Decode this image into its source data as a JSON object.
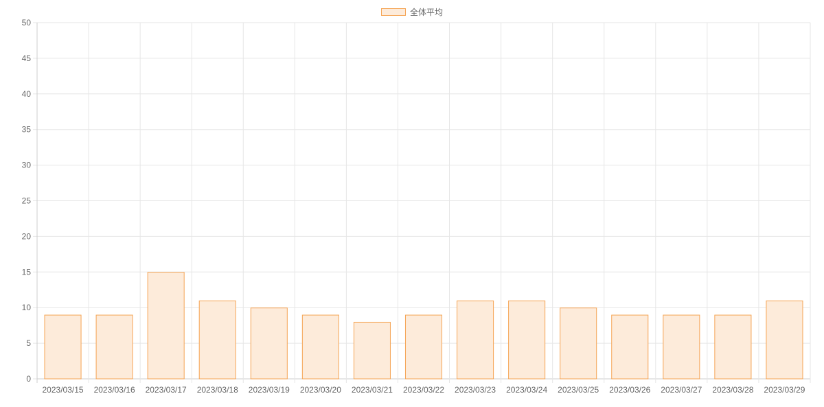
{
  "chart_data": {
    "type": "bar",
    "categories": [
      "2023/03/15",
      "2023/03/16",
      "2023/03/17",
      "2023/03/18",
      "2023/03/19",
      "2023/03/20",
      "2023/03/21",
      "2023/03/22",
      "2023/03/23",
      "2023/03/24",
      "2023/03/25",
      "2023/03/26",
      "2023/03/27",
      "2023/03/28",
      "2023/03/29"
    ],
    "series": [
      {
        "name": "全体平均",
        "values": [
          9,
          9,
          15,
          11,
          10,
          9,
          8,
          9,
          11,
          11,
          10,
          9,
          9,
          9,
          11
        ]
      }
    ],
    "ylim": [
      0,
      50
    ],
    "yticks": [
      0,
      5,
      10,
      15,
      20,
      25,
      30,
      35,
      40,
      45,
      50
    ],
    "grid": true,
    "legend_position": "top-center",
    "colors": {
      "bar_fill": "#fdebda",
      "bar_border": "#f5a454",
      "grid": "#e6e6e6",
      "tick_text": "#666666"
    }
  }
}
